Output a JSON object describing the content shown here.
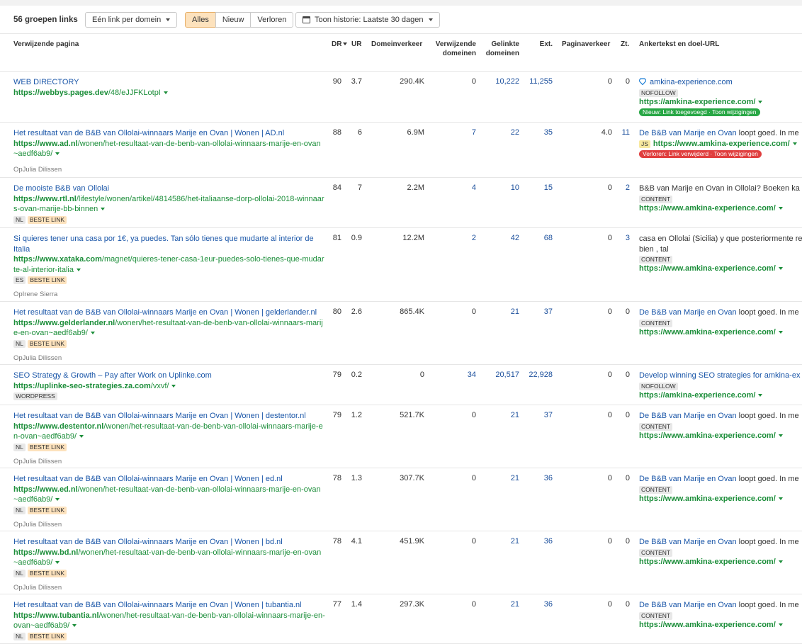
{
  "toolbar": {
    "group_count": "56 groepen links",
    "per_domain": "Eén link per domein",
    "filter_all": "Alles",
    "filter_new": "Nieuw",
    "filter_lost": "Verloren",
    "history": "Toon historie: Laatste 30 dagen"
  },
  "columns": {
    "page": "Verwijzende pagina",
    "dr": "DR",
    "ur": "UR",
    "domain_traffic": "Domeinverkeer",
    "ref_domains_1": "Verwijzende",
    "ref_domains_2": "domeinen",
    "linked_domains_1": "Gelinkte",
    "linked_domains_2": "domeinen",
    "ext": "Ext.",
    "page_traffic": "Paginaverkeer",
    "kw": "Zt.",
    "anchor": "Ankertekst en doel-URL"
  },
  "rows": [
    {
      "title": "WEB DIRECTORY",
      "url_domain": "https://webbys.pages.dev",
      "url_path": "/48/eJJFKLotpI",
      "tags": [],
      "author": "",
      "dr": "90",
      "ur": "3.7",
      "domain_traffic": "290.4K",
      "ref_domains": "0",
      "linked_domains": "10,222",
      "ext": "11,255",
      "page_traffic": "0",
      "kw": "0",
      "anchor_link": "amkina-experience.com",
      "anchor_rest": "",
      "anchor_type": "NOFOLLOW",
      "target_url": "https://amkina-experience.com/",
      "status": "Nieuw: Link toegevoegd · Toon wijzigingen",
      "status_kind": "new"
    },
    {
      "title": "Het resultaat van de B&B van Ollolai-winnaars Marije en Ovan | Wonen | AD.nl",
      "url_domain": "https://www.ad.nl",
      "url_path": "/wonen/het-resultaat-van-de-benb-van-ollolai-winnaars-marije-en-ovan~aedf6ab9/",
      "tags": [],
      "author": "OpJulia Dilissen",
      "dr": "88",
      "ur": "6",
      "domain_traffic": "6.9M",
      "ref_domains": "7",
      "linked_domains": "22",
      "ext": "35",
      "page_traffic": "4.0",
      "kw": "11",
      "anchor_link": "De B&B van Marije en Ovan",
      "anchor_rest": " loopt goed. In me",
      "anchor_type": "JS",
      "target_url": "https://www.amkina-experience.com/",
      "status": "Verloren: Link verwijderd · Toon wijzigingen",
      "status_kind": "lost"
    },
    {
      "title": "De mooiste B&B van Ollolai",
      "url_domain": "https://www.rtl.nl",
      "url_path": "/lifestyle/wonen/artikel/4814586/het-italiaanse-dorp-ollolai-2018-winnaars-ovan-marije-bb-binnen",
      "tags": [
        "NL",
        "BESTE LINK"
      ],
      "author": "",
      "dr": "84",
      "ur": "7",
      "domain_traffic": "2.2M",
      "ref_domains": "4",
      "linked_domains": "10",
      "ext": "15",
      "page_traffic": "0",
      "kw": "2",
      "anchor_link": "",
      "anchor_rest": "B&B van Marije en Ovan in Ollolai? Boeken ka",
      "anchor_type": "CONTENT",
      "target_url": "https://www.amkina-experience.com/",
      "status": "",
      "status_kind": ""
    },
    {
      "title": "Si quieres tener una casa por 1€, ya puedes. Tan sólo tienes que mudarte al interior de Italia",
      "url_domain": "https://www.xataka.com",
      "url_path": "/magnet/quieres-tener-casa-1eur-puedes-solo-tienes-que-mudarte-al-interior-italia",
      "tags": [
        "ES",
        "BESTE LINK"
      ],
      "author": "OpIrene Sierra",
      "dr": "81",
      "ur": "0.9",
      "domain_traffic": "12.2M",
      "ref_domains": "2",
      "linked_domains": "42",
      "ext": "68",
      "page_traffic": "0",
      "kw": "3",
      "anchor_link": "",
      "anchor_rest": "casa en Ollolai (Sicilia) y que posteriormente re",
      "anchor_rest2": "bien , tal",
      "anchor_type": "CONTENT",
      "target_url": "https://www.amkina-experience.com/",
      "status": "",
      "status_kind": ""
    },
    {
      "title": "Het resultaat van de B&B van Ollolai-winnaars Marije en Ovan | Wonen | gelderlander.nl",
      "url_domain": "https://www.gelderlander.nl",
      "url_path": "/wonen/het-resultaat-van-de-benb-van-ollolai-winnaars-marije-en-ovan~aedf6ab9/",
      "tags": [
        "NL",
        "BESTE LINK"
      ],
      "author": "OpJulia Dilissen",
      "dr": "80",
      "ur": "2.6",
      "domain_traffic": "865.4K",
      "ref_domains": "0",
      "linked_domains": "21",
      "ext": "37",
      "page_traffic": "0",
      "kw": "0",
      "anchor_link": "De B&B van Marije en Ovan",
      "anchor_rest": " loopt goed. In me",
      "anchor_type": "CONTENT",
      "target_url": "https://www.amkina-experience.com/",
      "status": "",
      "status_kind": ""
    },
    {
      "title": "SEO Strategy & Growth – Pay after Work on Uplinke.com",
      "url_domain": "https://uplinke-seo-strategies.za.com",
      "url_path": "/vxvf/",
      "tags": [
        "WORDPRESS"
      ],
      "author": "",
      "dr": "79",
      "ur": "0.2",
      "domain_traffic": "0",
      "ref_domains": "34",
      "linked_domains": "20,517",
      "ext": "22,928",
      "page_traffic": "0",
      "kw": "0",
      "anchor_link": "Develop winning SEO strategies for amkina-ex",
      "anchor_rest": "",
      "anchor_type": "NOFOLLOW",
      "target_url": "https://amkina-experience.com/",
      "status": "",
      "status_kind": ""
    },
    {
      "title": "Het resultaat van de B&B van Ollolai-winnaars Marije en Ovan | Wonen | destentor.nl",
      "url_domain": "https://www.destentor.nl",
      "url_path": "/wonen/het-resultaat-van-de-benb-van-ollolai-winnaars-marije-en-ovan~aedf6ab9/",
      "tags": [
        "NL",
        "BESTE LINK"
      ],
      "author": "OpJulia Dilissen",
      "dr": "79",
      "ur": "1.2",
      "domain_traffic": "521.7K",
      "ref_domains": "0",
      "linked_domains": "21",
      "ext": "37",
      "page_traffic": "0",
      "kw": "0",
      "anchor_link": "De B&B van Marije en Ovan",
      "anchor_rest": " loopt goed. In me",
      "anchor_type": "CONTENT",
      "target_url": "https://www.amkina-experience.com/",
      "status": "",
      "status_kind": ""
    },
    {
      "title": "Het resultaat van de B&B van Ollolai-winnaars Marije en Ovan | Wonen | ed.nl",
      "url_domain": "https://www.ed.nl",
      "url_path": "/wonen/het-resultaat-van-de-benb-van-ollolai-winnaars-marije-en-ovan~aedf6ab9/",
      "tags": [
        "NL",
        "BESTE LINK"
      ],
      "author": "OpJulia Dilissen",
      "dr": "78",
      "ur": "1.3",
      "domain_traffic": "307.7K",
      "ref_domains": "0",
      "linked_domains": "21",
      "ext": "36",
      "page_traffic": "0",
      "kw": "0",
      "anchor_link": "De B&B van Marije en Ovan",
      "anchor_rest": " loopt goed. In me",
      "anchor_type": "CONTENT",
      "target_url": "https://www.amkina-experience.com/",
      "status": "",
      "status_kind": ""
    },
    {
      "title": "Het resultaat van de B&B van Ollolai-winnaars Marije en Ovan | Wonen | bd.nl",
      "url_domain": "https://www.bd.nl",
      "url_path": "/wonen/het-resultaat-van-de-benb-van-ollolai-winnaars-marije-en-ovan~aedf6ab9/",
      "tags": [
        "NL",
        "BESTE LINK"
      ],
      "author": "OpJulia Dilissen",
      "dr": "78",
      "ur": "4.1",
      "domain_traffic": "451.9K",
      "ref_domains": "0",
      "linked_domains": "21",
      "ext": "36",
      "page_traffic": "0",
      "kw": "0",
      "anchor_link": "De B&B van Marije en Ovan",
      "anchor_rest": " loopt goed. In me",
      "anchor_type": "CONTENT",
      "target_url": "https://www.amkina-experience.com/",
      "status": "",
      "status_kind": ""
    },
    {
      "title": "Het resultaat van de B&B van Ollolai-winnaars Marije en Ovan | Wonen | tubantia.nl",
      "url_domain": "https://www.tubantia.nl",
      "url_path": "/wonen/het-resultaat-van-de-benb-van-ollolai-winnaars-marije-en-ovan~aedf6ab9/",
      "tags": [
        "NL",
        "BESTE LINK"
      ],
      "author": "",
      "dr": "77",
      "ur": "1.4",
      "domain_traffic": "297.3K",
      "ref_domains": "0",
      "linked_domains": "21",
      "ext": "36",
      "page_traffic": "0",
      "kw": "0",
      "anchor_link": "De B&B van Marije en Ovan",
      "anchor_rest": " loopt goed. In me",
      "anchor_type": "CONTENT",
      "target_url": "https://www.amkina-experience.com/",
      "status": "",
      "status_kind": ""
    }
  ]
}
